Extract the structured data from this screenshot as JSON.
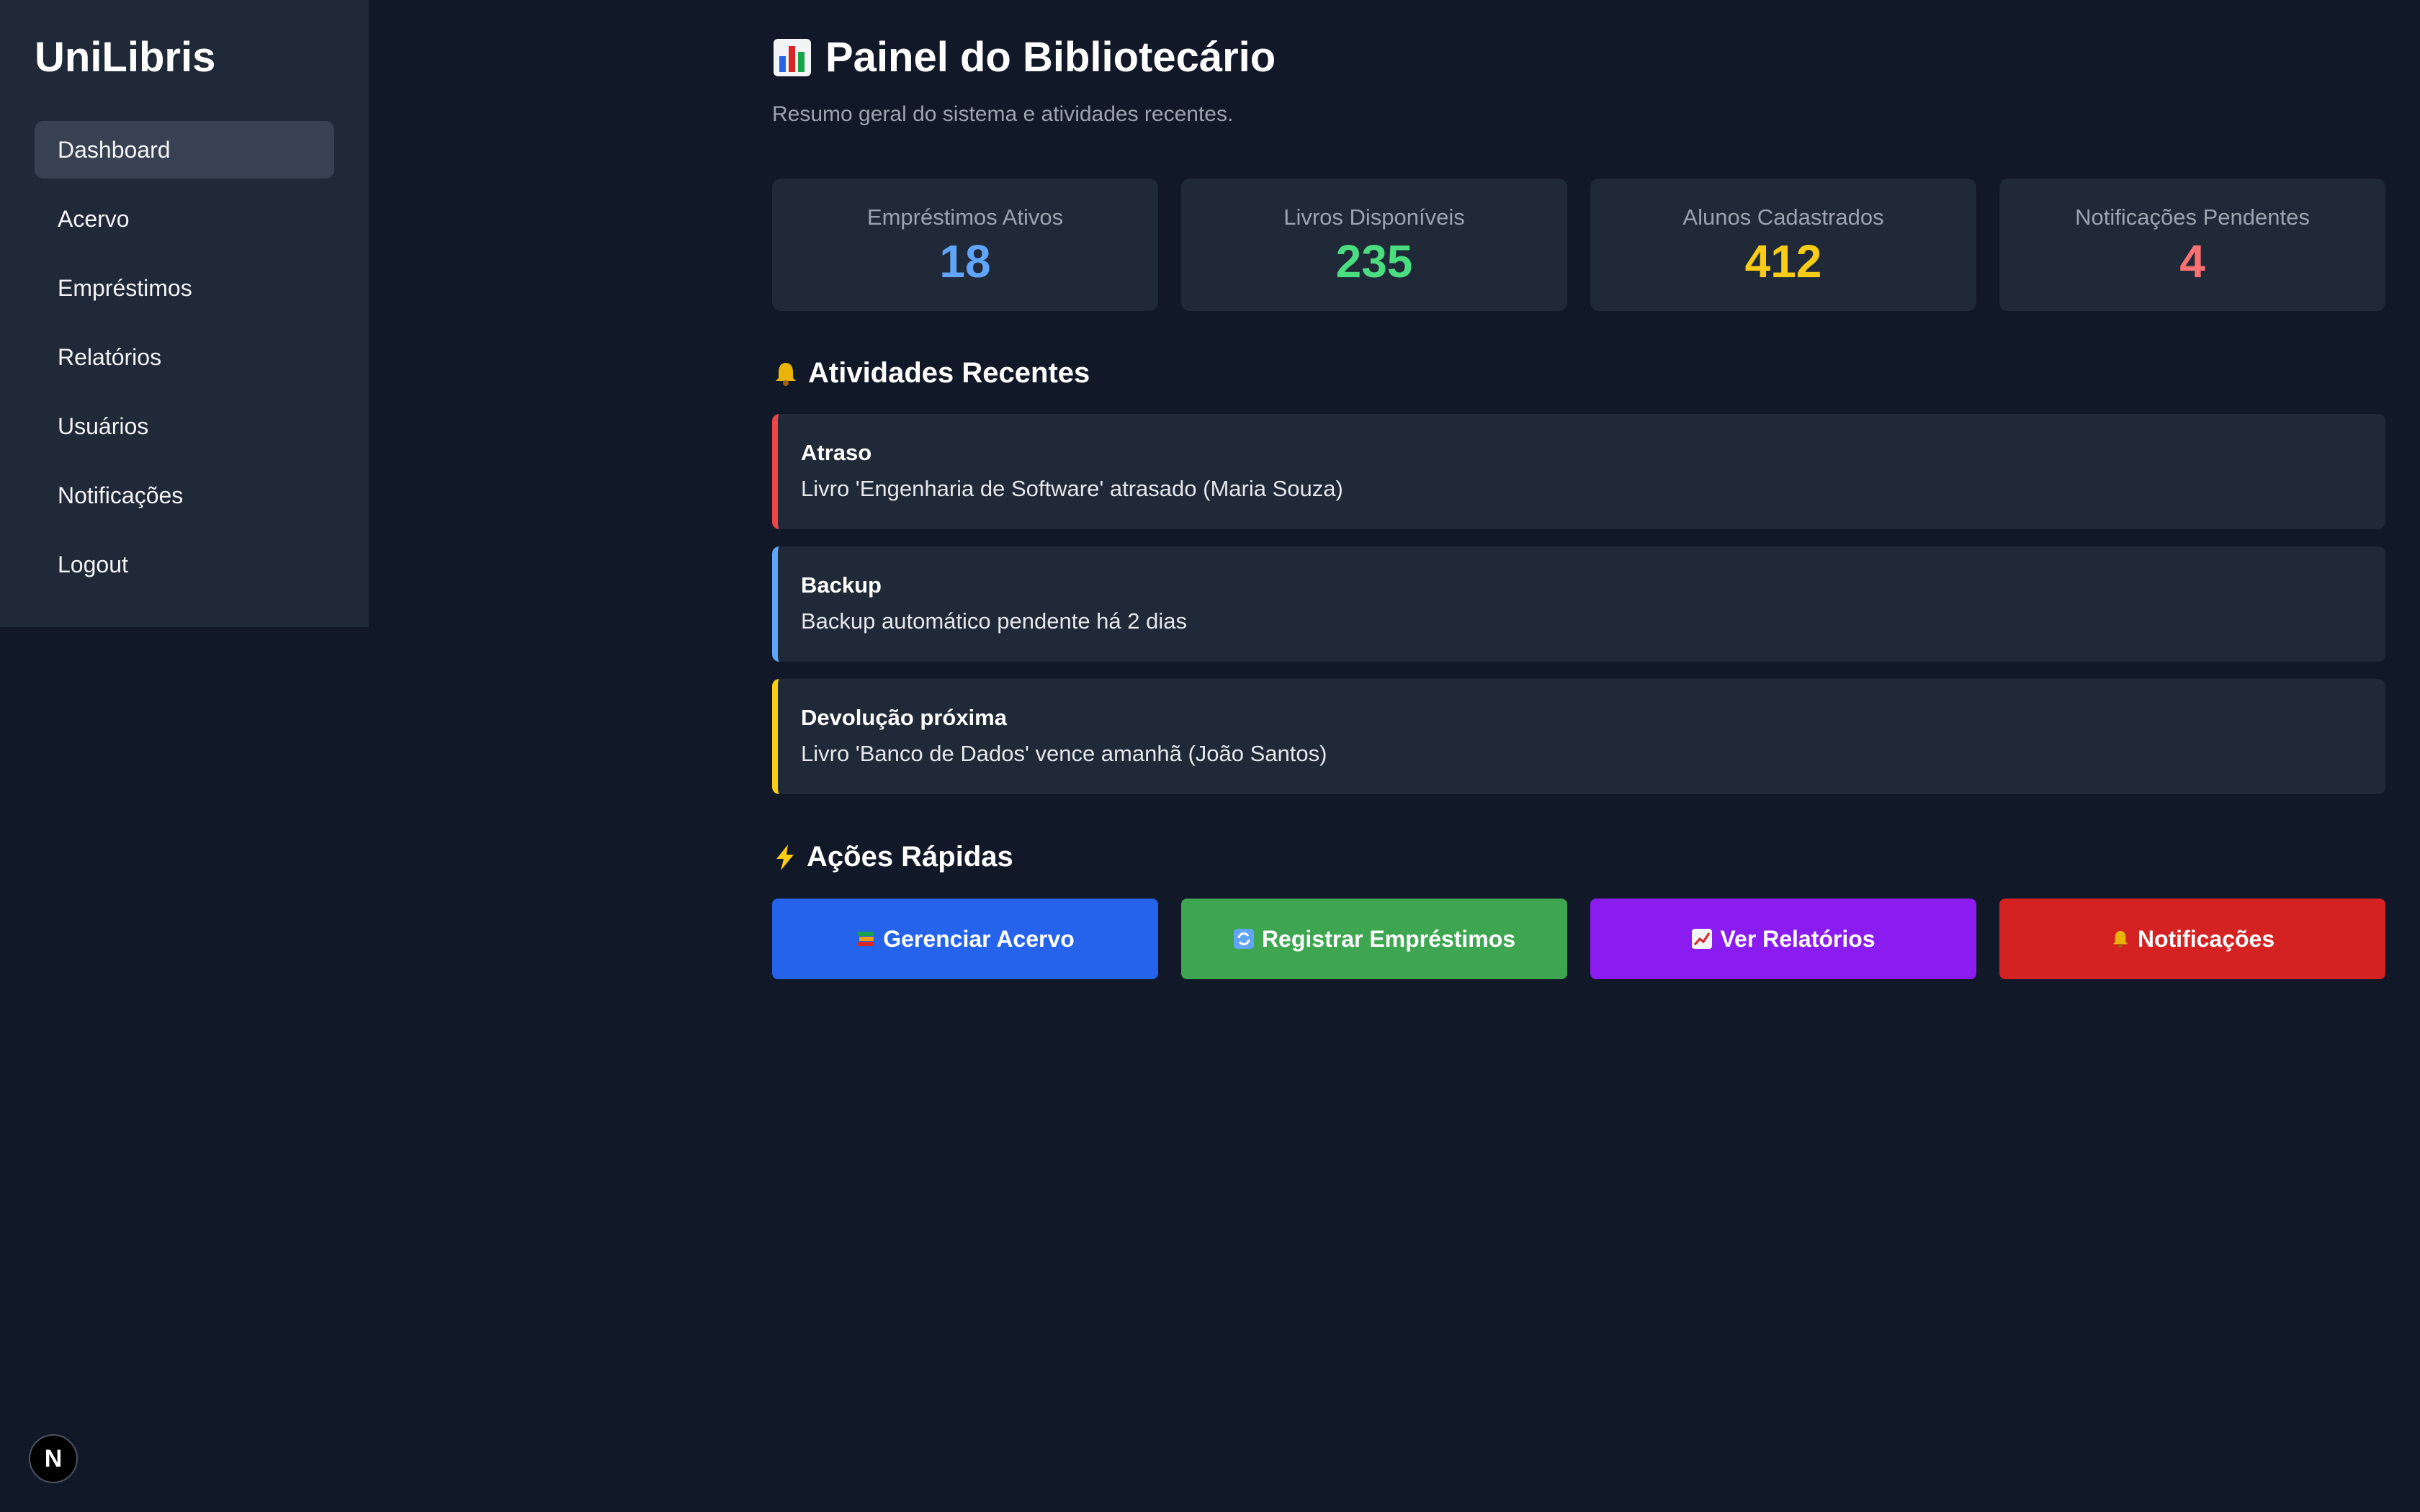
{
  "sidebar": {
    "brand": "UniLibris",
    "items": [
      {
        "label": "Dashboard",
        "active": true
      },
      {
        "label": "Acervo"
      },
      {
        "label": "Empréstimos"
      },
      {
        "label": "Relatórios"
      },
      {
        "label": "Usuários"
      },
      {
        "label": "Notificações"
      },
      {
        "label": "Logout"
      }
    ]
  },
  "header": {
    "title_icon": "bar-chart-icon",
    "title": "Painel do Bibliotecário",
    "subtitle": "Resumo geral do sistema e atividades recentes."
  },
  "stats": [
    {
      "label": "Empréstimos Ativos",
      "value": "18",
      "color": "#60a5fa"
    },
    {
      "label": "Livros Disponíveis",
      "value": "235",
      "color": "#4ade80"
    },
    {
      "label": "Alunos Cadastrados",
      "value": "412",
      "color": "#facc15"
    },
    {
      "label": "Notificações Pendentes",
      "value": "4",
      "color": "#f87171"
    }
  ],
  "activities_section": {
    "icon": "bell-icon",
    "title": "Atividades Recentes",
    "items": [
      {
        "title": "Atraso",
        "text": "Livro 'Engenharia de Software' atrasado (Maria Souza)",
        "color": "#ef4444"
      },
      {
        "title": "Backup",
        "text": "Backup automático pendente há 2 dias",
        "color": "#60a5fa"
      },
      {
        "title": "Devolução próxima",
        "text": "Livro 'Banco de Dados' vence amanhã (João Santos)",
        "color": "#facc15"
      }
    ]
  },
  "actions_section": {
    "icon": "lightning-icon",
    "title": "Ações Rápidas",
    "buttons": [
      {
        "label": "Gerenciar Acervo",
        "icon": "books-icon",
        "color": "#2563eb"
      },
      {
        "label": "Registrar Empréstimos",
        "icon": "refresh-icon",
        "color": "#3ea650"
      },
      {
        "label": "Ver Relatórios",
        "icon": "trend-chart-icon",
        "color": "#8b1cf0"
      },
      {
        "label": "Notificações",
        "icon": "bell-icon",
        "color": "#d42121"
      }
    ]
  },
  "badge": {
    "label": "N"
  }
}
